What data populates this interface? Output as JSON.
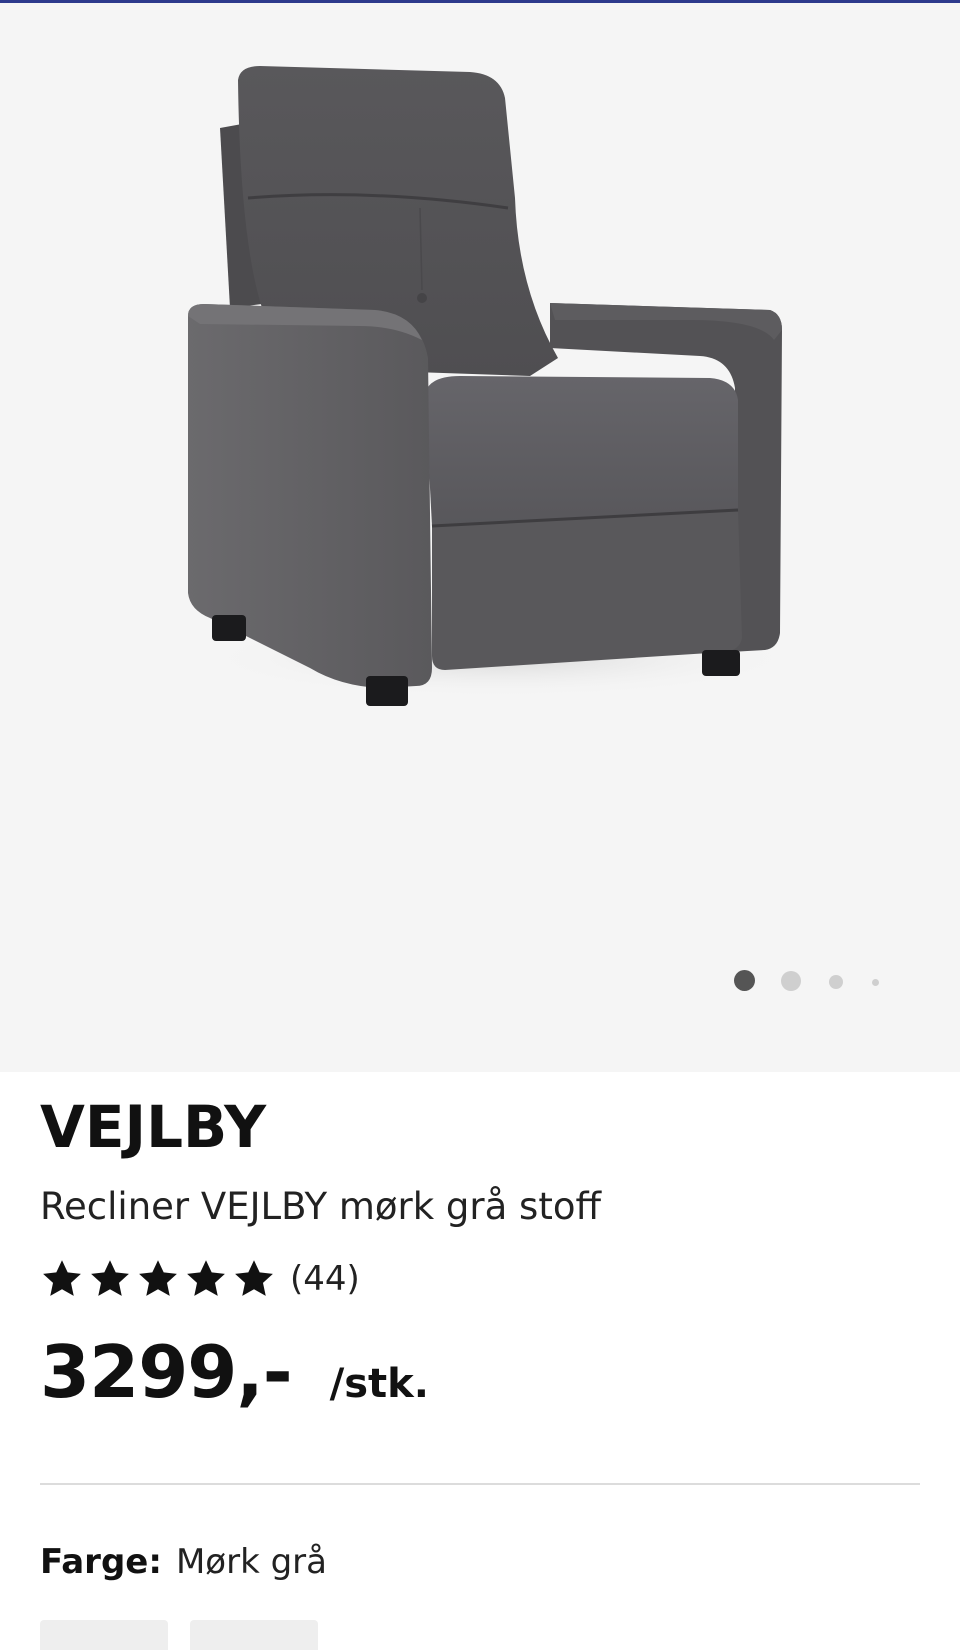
{
  "product": {
    "brand": "VEJLBY",
    "title": "Recliner VEJLBY mørk grå stoff",
    "rating": {
      "stars": 5,
      "max_stars": 5,
      "count_label": "(44)"
    },
    "price": "3299,-",
    "unit": "/stk.",
    "color": {
      "label": "Farge:",
      "value": "Mørk grå"
    }
  },
  "gallery": {
    "image_subject": "dark grey fabric recliner chair",
    "total_images": 4,
    "active_index": 0
  },
  "colors": {
    "accent_bar": "#2d3a8c",
    "gallery_bg": "#f5f5f5",
    "upholstery": "#5e5d60",
    "text": "#111111"
  },
  "icons": [
    "star-icon",
    "carousel-dot-icon"
  ]
}
